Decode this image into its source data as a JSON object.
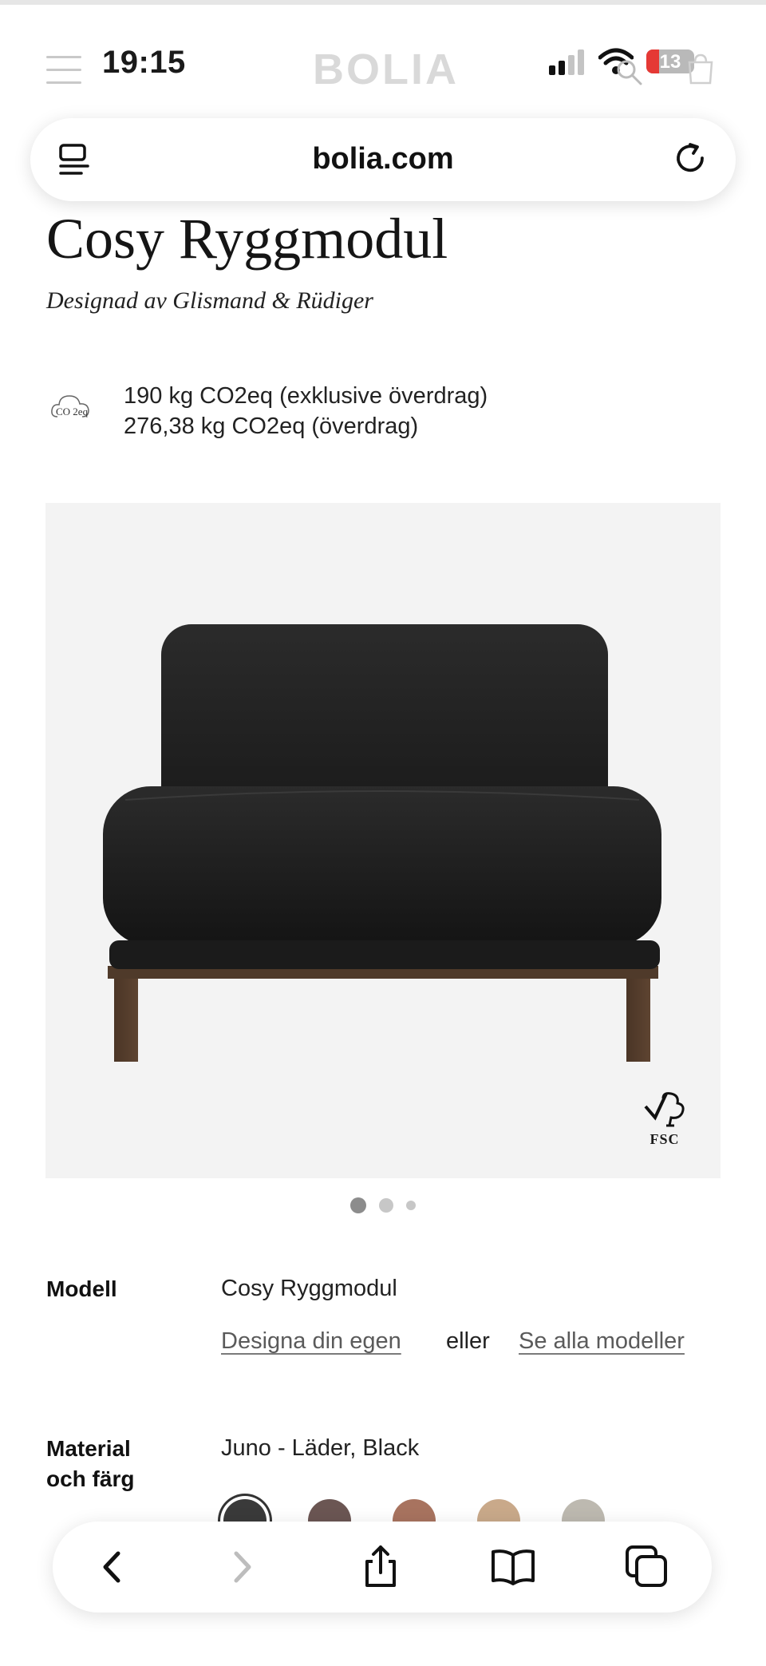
{
  "status_bar": {
    "time": "19:15",
    "battery": "13"
  },
  "site": {
    "brand": "BOLIA"
  },
  "browser": {
    "domain": "bolia.com"
  },
  "product": {
    "title": "Cosy Ryggmodul",
    "designer": "Designad av Glismand & Rüdiger",
    "co2_icon_text": "CO 2eq",
    "co2_line1": "190 kg CO2eq (exklusive överdrag)",
    "co2_line2": "276,38 kg CO2eq (överdrag)",
    "fsc_label": "FSC",
    "image_count": 3,
    "active_image": 1
  },
  "specs": {
    "model_label": "Modell",
    "model_value": "Cosy Ryggmodul",
    "design_own_link": "Designa din egen",
    "or_text": "eller",
    "see_all_link": "Se alla modeller",
    "material_label": "Material och färg",
    "material_value": "Juno - Läder, Black",
    "swatches": [
      {
        "name": "Black",
        "color": "#3a3a3a",
        "selected": true
      },
      {
        "name": "Brown",
        "color": "#6b5653",
        "selected": false
      },
      {
        "name": "Cognac",
        "color": "#a8735f",
        "selected": false
      },
      {
        "name": "Sand",
        "color": "#c9a98a",
        "selected": false
      },
      {
        "name": "Grey",
        "color": "#bdb9b0",
        "selected": false
      }
    ]
  },
  "colors": {
    "accent_dark": "#1a1a1a",
    "battery_low": "#e53935",
    "link_gray": "#5a5a5a"
  },
  "toolbar": {
    "icons": [
      "back-icon",
      "forward-icon",
      "share-icon",
      "bookmarks-icon",
      "tabs-icon"
    ]
  }
}
